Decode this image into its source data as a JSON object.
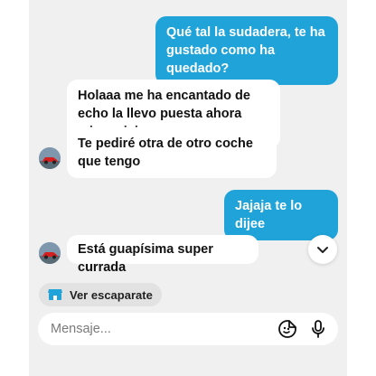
{
  "messages": {
    "outgoing_1": "Qué tal la sudadera, te ha gustado como ha quedado?",
    "incoming_1": "Holaaa me ha encantado de echo la llevo puesta ahora mismo jaja",
    "incoming_2": "Te pediré otra de otro coche que tengo",
    "outgoing_2": "Jajaja te lo dijee",
    "incoming_3": "Está guapísima super currada"
  },
  "shop_link": {
    "label": "Ver escaparate",
    "icon": "storefront-icon"
  },
  "composer": {
    "placeholder": "Mensaje...",
    "icons": [
      "sticker-icon",
      "microphone-icon"
    ]
  },
  "scroll_button": {
    "icon": "chevron-down-icon"
  },
  "colors": {
    "outgoing_bubble": "#1fa3d9",
    "incoming_bubble": "#ffffff",
    "background": "#f0f0f0"
  }
}
